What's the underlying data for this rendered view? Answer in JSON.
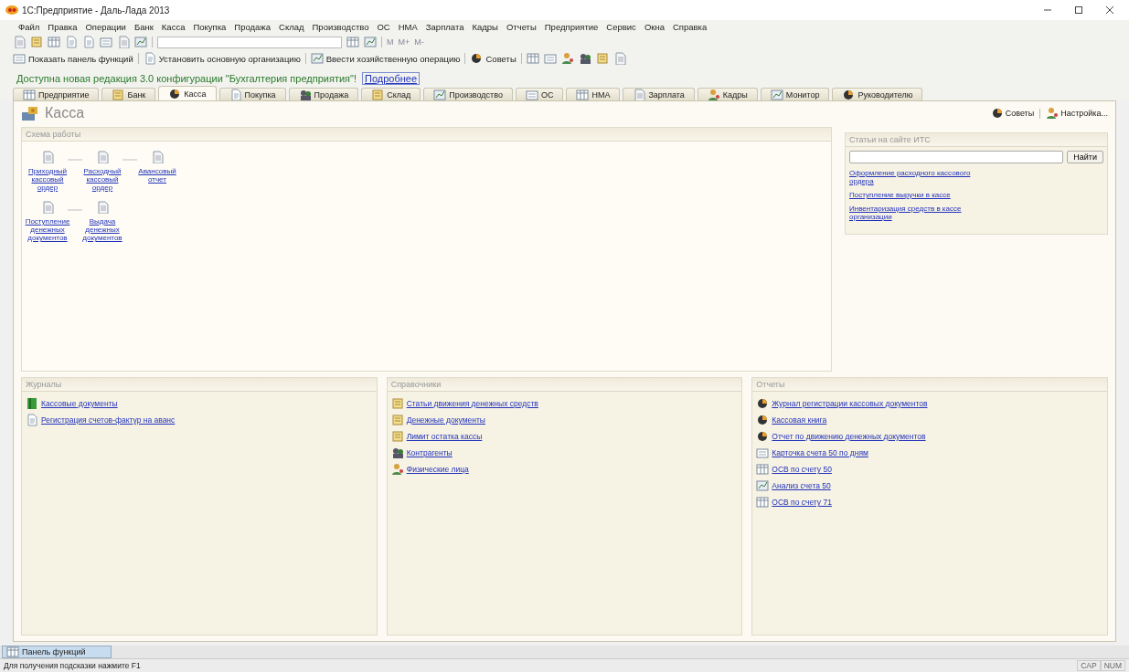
{
  "window": {
    "title": "1С:Предприятие - Даль-Лада 2013"
  },
  "menu": [
    "Файл",
    "Правка",
    "Операции",
    "Банк",
    "Касса",
    "Покупка",
    "Продажа",
    "Склад",
    "Производство",
    "ОС",
    "НМА",
    "Зарплата",
    "Кадры",
    "Отчеты",
    "Предприятие",
    "Сервис",
    "Окна",
    "Справка"
  ],
  "toolbar": {
    "memory_keys": [
      "M",
      "M+",
      "M-"
    ]
  },
  "toolbar2": [
    "Показать панель функций",
    "Установить основную организацию",
    "Ввести хозяйственную операцию",
    "Советы"
  ],
  "notice": {
    "text": "Доступна новая редакция 3.0 конфигурации \"Бухгалтерия предприятия\"!",
    "link": "Подробнее"
  },
  "tabs": [
    {
      "label": "Предприятие",
      "selected": false
    },
    {
      "label": "Банк",
      "selected": false
    },
    {
      "label": "Касса",
      "selected": true
    },
    {
      "label": "Покупка",
      "selected": false
    },
    {
      "label": "Продажа",
      "selected": false
    },
    {
      "label": "Склад",
      "selected": false
    },
    {
      "label": "Производство",
      "selected": false
    },
    {
      "label": "ОС",
      "selected": false
    },
    {
      "label": "НМА",
      "selected": false
    },
    {
      "label": "Зарплата",
      "selected": false
    },
    {
      "label": "Кадры",
      "selected": false
    },
    {
      "label": "Монитор",
      "selected": false
    },
    {
      "label": "Руководителю",
      "selected": false
    }
  ],
  "page": {
    "title": "Касса",
    "actions": [
      "Советы",
      "Настройка..."
    ]
  },
  "scheme": {
    "title": "Схема работы",
    "rows": [
      [
        "Приходный кассовый ордер",
        "Расходный кассовый ордер",
        "Авансовый отчет"
      ],
      [
        "Поступление денежных документов",
        "Выдача денежных документов"
      ]
    ]
  },
  "its": {
    "title": "Статьи на сайте ИТС",
    "button": "Найти",
    "links": [
      "Оформление расходного кассового ордера",
      "Поступление выручки в кассе",
      "Инвентаризация средств в кассе организации"
    ]
  },
  "panels": [
    {
      "title": "Журналы",
      "items": [
        {
          "kind": "journal",
          "label": "Кассовые документы"
        },
        {
          "kind": "doc",
          "label": "Регистрация счетов-фактур на аванс"
        }
      ]
    },
    {
      "title": "Справочники",
      "items": [
        {
          "kind": "folder",
          "label": "Статьи движения денежных средств"
        },
        {
          "kind": "folder",
          "label": "Денежные документы"
        },
        {
          "kind": "folder",
          "label": "Лимит остатка кассы"
        },
        {
          "kind": "people",
          "label": "Контрагенты"
        },
        {
          "kind": "person",
          "label": "Физические лица"
        }
      ]
    },
    {
      "title": "Отчеты",
      "items": [
        {
          "kind": "report",
          "label": "Журнал регистрации кассовых документов"
        },
        {
          "kind": "report",
          "label": "Кассовая книга"
        },
        {
          "kind": "report",
          "label": "Отчет по движению денежных документов"
        },
        {
          "kind": "card",
          "label": "Карточка счета 50 по дням"
        },
        {
          "kind": "table",
          "label": "ОСВ по счету 50"
        },
        {
          "kind": "analysis",
          "label": "Анализ счета 50"
        },
        {
          "kind": "table",
          "label": "ОСВ по счету 71"
        }
      ]
    }
  ],
  "taskbar": {
    "button": "Панель функций"
  },
  "status_bar": {
    "hint": "Для получения подсказки нажмите F1",
    "indicators": [
      "CAP",
      "NUM"
    ]
  }
}
